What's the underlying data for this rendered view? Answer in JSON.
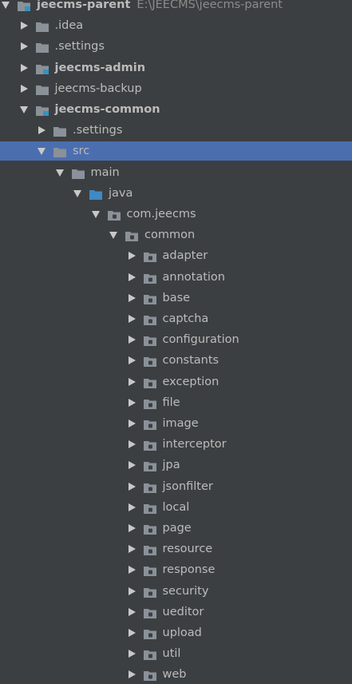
{
  "tree": [
    {
      "label": "jeecms-parent",
      "path": "E:\\JEECMS\\jeecms-parent",
      "level": 0,
      "arrow": "down",
      "icon": "module",
      "bold": true
    },
    {
      "label": ".idea",
      "level": 1,
      "arrow": "right",
      "icon": "folder"
    },
    {
      "label": ".settings",
      "level": 1,
      "arrow": "right",
      "icon": "folder"
    },
    {
      "label": "jeecms-admin",
      "level": 1,
      "arrow": "right",
      "icon": "module",
      "bold": true
    },
    {
      "label": "jeecms-backup",
      "level": 1,
      "arrow": "right",
      "icon": "folder"
    },
    {
      "label": "jeecms-common",
      "level": 1,
      "arrow": "down",
      "icon": "module",
      "bold": true
    },
    {
      "label": ".settings",
      "level": 2,
      "arrow": "right",
      "icon": "folder"
    },
    {
      "label": "src",
      "level": 2,
      "arrow": "down",
      "icon": "folder",
      "selected": true
    },
    {
      "label": "main",
      "level": 3,
      "arrow": "down",
      "icon": "folder"
    },
    {
      "label": "java",
      "level": 4,
      "arrow": "down",
      "icon": "source-folder"
    },
    {
      "label": "com.jeecms",
      "level": 5,
      "arrow": "down",
      "icon": "package"
    },
    {
      "label": "common",
      "level": 6,
      "arrow": "down",
      "icon": "package"
    },
    {
      "label": "adapter",
      "level": 7,
      "arrow": "right",
      "icon": "package"
    },
    {
      "label": "annotation",
      "level": 7,
      "arrow": "right",
      "icon": "package"
    },
    {
      "label": "base",
      "level": 7,
      "arrow": "right",
      "icon": "package"
    },
    {
      "label": "captcha",
      "level": 7,
      "arrow": "right",
      "icon": "package"
    },
    {
      "label": "configuration",
      "level": 7,
      "arrow": "right",
      "icon": "package"
    },
    {
      "label": "constants",
      "level": 7,
      "arrow": "right",
      "icon": "package"
    },
    {
      "label": "exception",
      "level": 7,
      "arrow": "right",
      "icon": "package"
    },
    {
      "label": "file",
      "level": 7,
      "arrow": "right",
      "icon": "package"
    },
    {
      "label": "image",
      "level": 7,
      "arrow": "right",
      "icon": "package"
    },
    {
      "label": "interceptor",
      "level": 7,
      "arrow": "right",
      "icon": "package"
    },
    {
      "label": "jpa",
      "level": 7,
      "arrow": "right",
      "icon": "package"
    },
    {
      "label": "jsonfilter",
      "level": 7,
      "arrow": "right",
      "icon": "package"
    },
    {
      "label": "local",
      "level": 7,
      "arrow": "right",
      "icon": "package"
    },
    {
      "label": "page",
      "level": 7,
      "arrow": "right",
      "icon": "package"
    },
    {
      "label": "resource",
      "level": 7,
      "arrow": "right",
      "icon": "package"
    },
    {
      "label": "response",
      "level": 7,
      "arrow": "right",
      "icon": "package"
    },
    {
      "label": "security",
      "level": 7,
      "arrow": "right",
      "icon": "package"
    },
    {
      "label": "ueditor",
      "level": 7,
      "arrow": "right",
      "icon": "package"
    },
    {
      "label": "upload",
      "level": 7,
      "arrow": "right",
      "icon": "package"
    },
    {
      "label": "util",
      "level": 7,
      "arrow": "right",
      "icon": "package"
    },
    {
      "label": "web",
      "level": 7,
      "arrow": "right",
      "icon": "package"
    }
  ],
  "colors": {
    "background": "#3c3f41",
    "selection": "#4b6eaf",
    "text": "#bbbbbb",
    "folder": "#8a9199",
    "source_folder": "#3f8ac4",
    "module_badge": "#3592c4"
  }
}
